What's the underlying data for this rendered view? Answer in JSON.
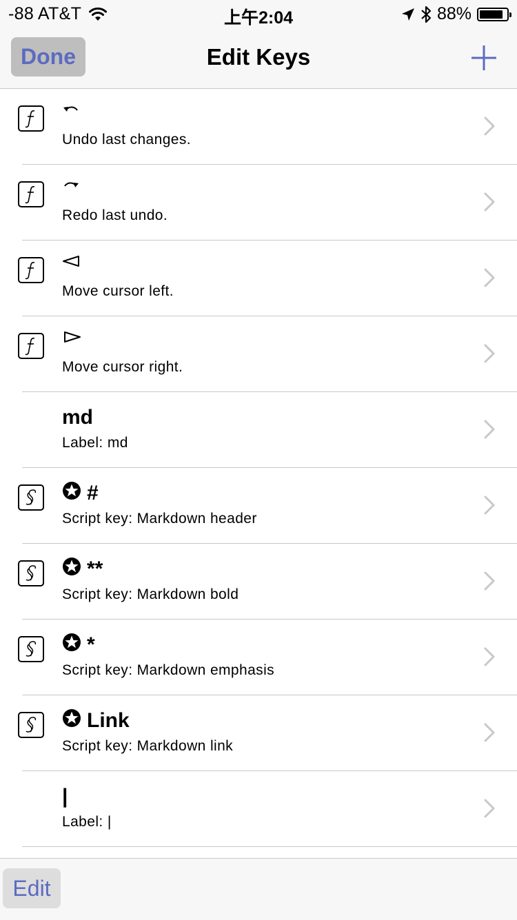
{
  "status_bar": {
    "carrier": "-88 AT&T",
    "time": "上午2:04",
    "battery": "88%",
    "battery_level": 0.88
  },
  "nav": {
    "done_label": "Done",
    "title": "Edit Keys"
  },
  "rows": [
    {
      "icon": "function-icon",
      "title_icon": "undo-arrow-icon",
      "title": "",
      "subtitle": "Undo last changes."
    },
    {
      "icon": "function-icon",
      "title_icon": "redo-arrow-icon",
      "title": "",
      "subtitle": "Redo last undo."
    },
    {
      "icon": "function-icon",
      "title_icon": "left-triangle-icon",
      "title": "",
      "subtitle": "Move cursor left."
    },
    {
      "icon": "function-icon",
      "title_icon": "right-triangle-icon",
      "title": "",
      "subtitle": "Move cursor right."
    },
    {
      "icon": "",
      "title_icon": "",
      "title": "md",
      "subtitle": "Label: md"
    },
    {
      "icon": "script-icon",
      "title_icon": "star-circle-icon",
      "title": "#",
      "subtitle": "Script key: Markdown header"
    },
    {
      "icon": "script-icon",
      "title_icon": "star-circle-icon",
      "title": "**",
      "subtitle": "Script key: Markdown bold"
    },
    {
      "icon": "script-icon",
      "title_icon": "star-circle-icon",
      "title": "*",
      "subtitle": "Script key: Markdown emphasis"
    },
    {
      "icon": "script-icon",
      "title_icon": "star-circle-icon",
      "title": "Link",
      "subtitle": "Script key: Markdown link"
    },
    {
      "icon": "",
      "title_icon": "",
      "title": "|",
      "subtitle": "Label: |"
    }
  ],
  "toolbar": {
    "edit_label": "Edit"
  },
  "colors": {
    "accent": "#5c6bc0",
    "separator": "#c8c7cc",
    "bar_background": "#f7f7f7"
  }
}
